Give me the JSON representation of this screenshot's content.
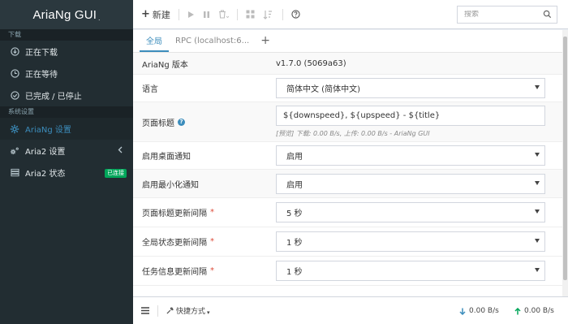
{
  "app": {
    "logo_text": "AriaNg GUI",
    "logo_suffix": "."
  },
  "sidebar": {
    "sections": [
      {
        "header": "下载",
        "items": [
          {
            "label": "正在下载",
            "icon": "download-icon"
          },
          {
            "label": "正在等待",
            "icon": "clock-icon"
          },
          {
            "label": "已完成 / 已停止",
            "icon": "check-circle-icon"
          }
        ]
      },
      {
        "header": "系统设置",
        "items": [
          {
            "label": "AriaNg 设置",
            "icon": "gear-icon",
            "active": true
          },
          {
            "label": "Aria2 设置",
            "icon": "gears-icon"
          },
          {
            "label": "Aria2 状态",
            "icon": "server-icon",
            "badge": "已连接"
          }
        ]
      }
    ]
  },
  "toolbar": {
    "new_label": "新建",
    "search_placeholder": "搜索"
  },
  "tabs": {
    "global": "全局",
    "rpc": "RPC (localhost:6...",
    "add": "+"
  },
  "settings": {
    "version_label": "AriaNg 版本",
    "version_value": "v1.7.0 (5069a63)",
    "language_label": "语言",
    "language_value": "简体中文 (简体中文)",
    "page_title_label": "页面标题",
    "page_title_value": "${downspeed}, ${upspeed} - ${title}",
    "page_title_preview": "[预览] 下载: 0.00 B/s, 上传: 0.00 B/s - AriaNg GUI",
    "desktop_notify_label": "启用桌面通知",
    "desktop_notify_value": "启用",
    "minimize_notify_label": "启用最小化通知",
    "minimize_notify_value": "启用",
    "title_interval_label": "页面标题更新间隔",
    "title_interval_value": "5 秒",
    "global_interval_label": "全局状态更新间隔",
    "global_interval_value": "1 秒",
    "task_interval_label": "任务信息更新间隔",
    "task_interval_value": "1 秒",
    "required_mark": "*"
  },
  "footer": {
    "shortcut_label": "快捷方式",
    "download_speed": "0.00 B/s",
    "upload_speed": "0.00 B/s"
  },
  "colors": {
    "sidebar_bg": "#222d32",
    "accent": "#3c8dbc",
    "badge_green": "#00a65a",
    "download_arrow": "#3c8dbc",
    "upload_arrow": "#00a65a"
  }
}
